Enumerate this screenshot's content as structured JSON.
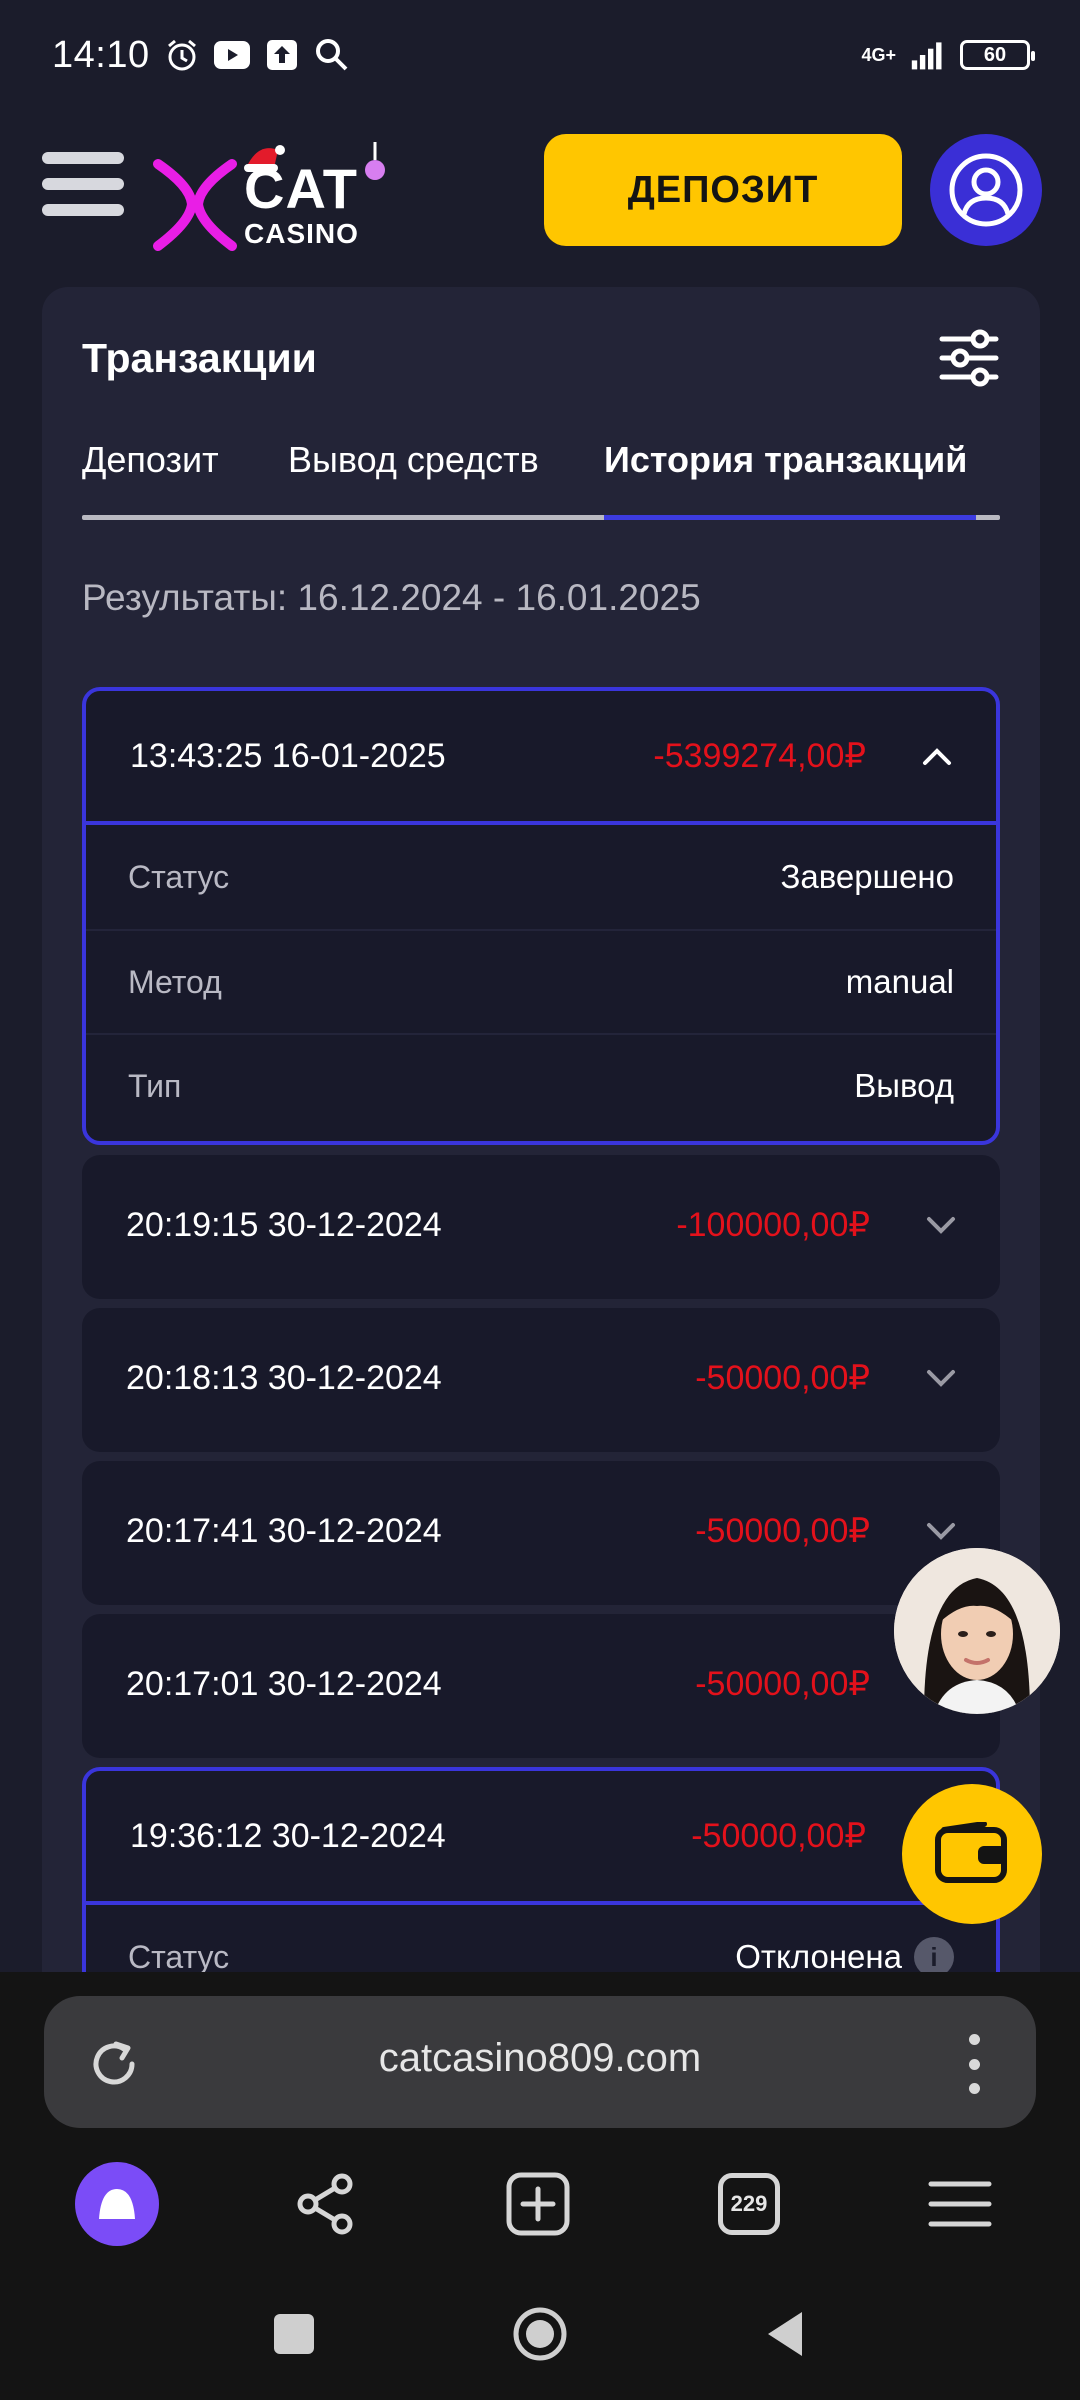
{
  "status_bar": {
    "time": "14:10",
    "network": "4G+",
    "battery": "60"
  },
  "header": {
    "logo_top": "CAT",
    "logo_bottom": "CASINO",
    "deposit_label": "ДЕПОЗИТ"
  },
  "panel": {
    "title": "Транзакции",
    "tabs": [
      "Депозит",
      "Вывод средств",
      "История транзакций"
    ],
    "active_tab": "История транзакций",
    "results": "Результаты: 16.12.2024 - 16.01.2025"
  },
  "transactions": [
    {
      "datetime": "13:43:25 16-01-2025",
      "amount": "-5399274,00₽",
      "expanded": true,
      "details": [
        {
          "label": "Статус",
          "value": "Завершено"
        },
        {
          "label": "Метод",
          "value": "manual"
        },
        {
          "label": "Тип",
          "value": "Вывод"
        }
      ]
    },
    {
      "datetime": "20:19:15 30-12-2024",
      "amount": "-100000,00₽",
      "expanded": false
    },
    {
      "datetime": "20:18:13 30-12-2024",
      "amount": "-50000,00₽",
      "expanded": false
    },
    {
      "datetime": "20:17:41 30-12-2024",
      "amount": "-50000,00₽",
      "expanded": false
    },
    {
      "datetime": "20:17:01 30-12-2024",
      "amount": "-50000,00₽",
      "expanded": false
    },
    {
      "datetime": "19:36:12 30-12-2024",
      "amount": "-50000,00₽",
      "expanded": true,
      "details": [
        {
          "label": "Статус",
          "value": "Отклонена"
        }
      ]
    }
  ],
  "browser": {
    "url": "catcasino809.com",
    "tabs_count": "229"
  },
  "colors": {
    "accent_yellow": "#ffc600",
    "accent_blue": "#3a35dc",
    "negative_red": "#e3111b",
    "background": "#1b1c2b",
    "panel": "#232437"
  }
}
